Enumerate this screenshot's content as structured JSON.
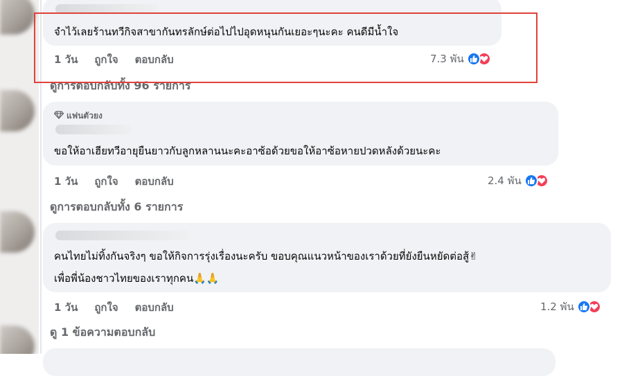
{
  "comments": [
    {
      "text_lines": [
        "จำไว้เลยร้านทวีกิจสาขากันทรลักษ์ต่อไปไปอุดหนุนกันเยอะๆนะคะ คนดีมีน้ำใจ"
      ],
      "time": "1 วัน",
      "like_label": "ถูกใจ",
      "reply_label": "ตอบกลับ",
      "reaction_count": "7.3 พัน",
      "view_replies": "ดูการตอบกลับทั้ง 96 รายการ",
      "highlighted": true
    },
    {
      "badge": "แฟนตัวยง",
      "text_lines": [
        "ขอให้อาเฮียทวีอายุยืนยาวกับลูกหลานนะคะอาซ้อด้วยขอให้อาซ้อหายปวดหลังด้วยนะคะ"
      ],
      "time": "1 วัน",
      "like_label": "ถูกใจ",
      "reply_label": "ตอบกลับ",
      "reaction_count": "2.4 พัน",
      "view_replies": "ดูการตอบกลับทั้ง 6 รายการ"
    },
    {
      "text_lines": [
        "คนไทยไม่ทิ้งกันจริงๆ ขอให้กิจการรุ่งเรื่องนะครับ ขอบคุณแนวหน้าของเราด้วยที่ยังยืนหยัดต่อสู้✌",
        "เพื่อพี่น้องชาวไทยของเราทุกคน🙏🙏"
      ],
      "time": "1 วัน",
      "like_label": "ถูกใจ",
      "reply_label": "ตอบกลับ",
      "reaction_count": "1.2 พัน",
      "view_replies": "ดู 1 ข้อความตอบกลับ"
    }
  ],
  "icons": {
    "like": "thumbs-up-icon",
    "love": "heart-icon",
    "badge": "diamond-icon"
  },
  "colors": {
    "highlight": "#e0403a",
    "like": "#1877f2",
    "love": "#f33e58",
    "bubble": "#f0f2f5",
    "muted": "#65676b"
  }
}
